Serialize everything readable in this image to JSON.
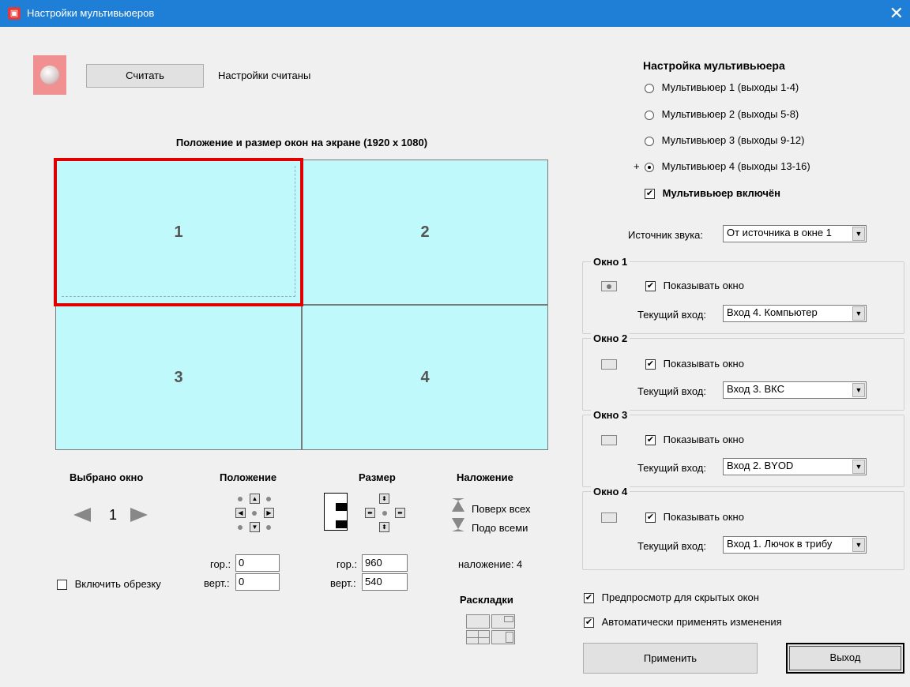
{
  "window": {
    "title": "Настройки мультивьюеров",
    "close_glyph": "✕"
  },
  "top": {
    "read_button": "Считать",
    "status": "Настройки считаны"
  },
  "layout_area": {
    "title": "Положение и размер окон на экране (1920 x 1080)",
    "cells": [
      "1",
      "2",
      "3",
      "4"
    ],
    "cell_color": "#bff9fb",
    "selected_color": "#e00000"
  },
  "selected_window": {
    "label": "Выбрано окно",
    "value": "1",
    "crop_label": "Включить обрезку"
  },
  "position": {
    "label": "Положение",
    "h_label": "гор.:",
    "h_value": "0",
    "v_label": "верт.:",
    "v_value": "0"
  },
  "size": {
    "label": "Размер",
    "h_label": "гор.:",
    "h_value": "960",
    "v_label": "верт.:",
    "v_value": "540"
  },
  "overlay": {
    "label": "Наложение",
    "top": "Поверх всех",
    "bottom": "Подо всеми",
    "value_text": "наложение: 4"
  },
  "layouts": {
    "label": "Раскладки"
  },
  "multiviewer": {
    "header": "Настройка мультивьюера",
    "options": [
      {
        "label": "Мультивьюер 1 (выходы 1-4)",
        "marker": ""
      },
      {
        "label": "Мультивьюер 2 (выходы 5-8)",
        "marker": ""
      },
      {
        "label": "Мультивьюер 3 (выходы 9-12)",
        "marker": ""
      },
      {
        "label": "Мультивьюер 4 (выходы 13-16)",
        "marker": "+"
      }
    ],
    "enabled_label": "Мультивьюер включён"
  },
  "audio": {
    "label": "Источник звука:",
    "value": "От источника в окне 1"
  },
  "windows": [
    {
      "title": "Окно 1",
      "show_label": "Показывать окно",
      "input_label": "Текущий вход:",
      "input_value": "Вход 4. Компьютер"
    },
    {
      "title": "Окно 2",
      "show_label": "Показывать окно",
      "input_label": "Текущий вход:",
      "input_value": "Вход 3. ВКС"
    },
    {
      "title": "Окно 3",
      "show_label": "Показывать окно",
      "input_label": "Текущий вход:",
      "input_value": "Вход 2. BYOD"
    },
    {
      "title": "Окно 4",
      "show_label": "Показывать окно",
      "input_label": "Текущий вход:",
      "input_value": "Вход 1. Лючок в трибу"
    }
  ],
  "bottom": {
    "preview_label": "Предпросмотр для скрытых окон",
    "auto_apply_label": "Автоматически применять изменения",
    "apply_button": "Применить",
    "exit_button": "Выход"
  }
}
